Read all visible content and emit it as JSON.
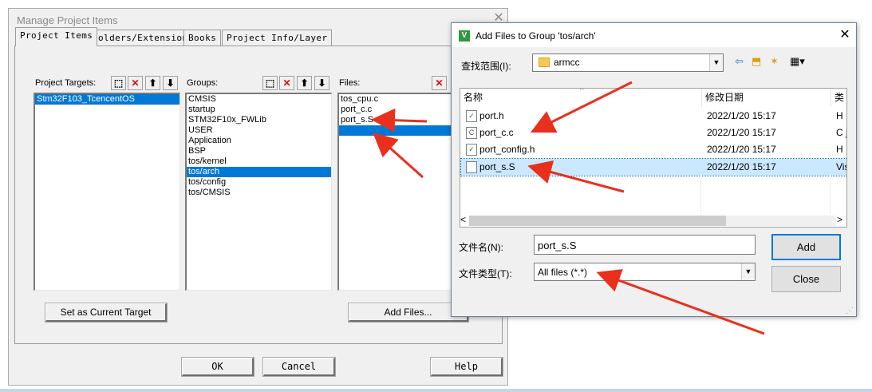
{
  "manage_window": {
    "title": "Manage Project Items",
    "tabs": [
      "Project Items",
      "Folders/Extensions",
      "Books",
      "Project Info/Layer"
    ],
    "project_targets": {
      "label": "Project Targets:",
      "items": [
        "Stm32F103_TcencentOS"
      ]
    },
    "groups": {
      "label": "Groups:",
      "items": [
        "CMSIS",
        "startup",
        "STM32F10x_FWLib",
        "USER",
        "Application",
        "BSP",
        "tos/kernel",
        "tos/arch",
        "tos/config",
        "tos/CMSIS"
      ],
      "selected_index": 7
    },
    "files": {
      "label": "Files:",
      "items": [
        "tos_cpu.c",
        "port_c.c",
        "port_s.S",
        ""
      ],
      "selected_index": 3
    },
    "set_target_button": "Set as Current Target",
    "add_files_button": "Add Files...",
    "ok_button": "OK",
    "cancel_button": "Cancel",
    "help_button": "Help"
  },
  "add_files_dialog": {
    "title": "Add Files to Group 'tos/arch'",
    "app_icon_letter": "V",
    "look_in_label": "查找范围(I):",
    "look_in_value": "armcc",
    "columns": [
      "名称",
      "修改日期",
      "类"
    ],
    "files": [
      {
        "name": "port.h",
        "date": "2022/1/20 15:17",
        "type": "H :"
      },
      {
        "name": "port_c.c",
        "date": "2022/1/20 15:17",
        "type": "C j"
      },
      {
        "name": "port_config.h",
        "date": "2022/1/20 15:17",
        "type": "H :"
      },
      {
        "name": "port_s.S",
        "date": "2022/1/20 15:17",
        "type": "Vis"
      }
    ],
    "selected_file_index": 3,
    "filename_label": "文件名(N):",
    "filename_value": "port_s.S",
    "filetype_label": "文件类型(T):",
    "filetype_value": "All files (*.*)",
    "add_button": "Add",
    "close_button": "Close"
  },
  "colors": {
    "selection": "#0078d7",
    "annotation_arrow": "#e8301c"
  },
  "icons": [
    "close-icon",
    "new-item-icon",
    "delete-icon",
    "move-up-icon",
    "move-down-icon",
    "folder-icon",
    "back-icon",
    "up-folder-icon",
    "new-folder-icon",
    "view-menu-icon",
    "file-icon"
  ]
}
